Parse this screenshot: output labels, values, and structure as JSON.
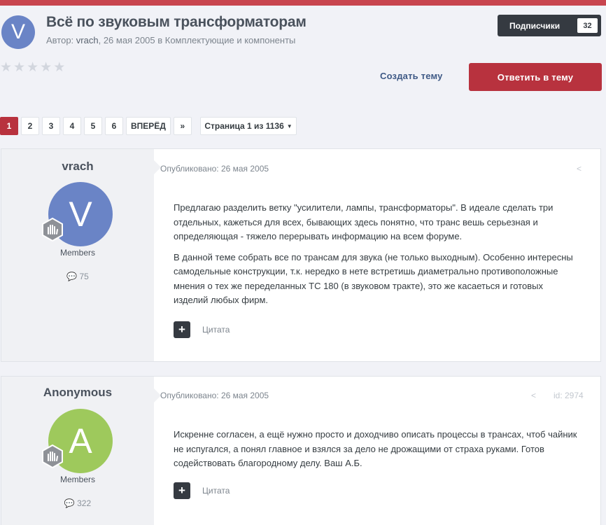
{
  "topic": {
    "avatar_letter": "V",
    "title": "Всё по звуковым трансформаторам",
    "author_prefix": "Автор:",
    "author": "vrach",
    "date_forum": ", 26 мая 2005 в Комплектующие и компоненты",
    "rating_stars": 5,
    "rating_value": 0
  },
  "follow": {
    "label": "Подписчики",
    "count": "32"
  },
  "actions": {
    "create": "Создать тему",
    "reply": "Ответить в тему"
  },
  "pagination": {
    "pages": [
      "1",
      "2",
      "3",
      "4",
      "5",
      "6"
    ],
    "current": "1",
    "next": "ВПЕРЁД",
    "last": "»",
    "page_select": "Страница 1 из 1136"
  },
  "posts": [
    {
      "username": "vrach",
      "avatar_letter": "V",
      "avatar_color": "#6a84c6",
      "group": "Members",
      "post_count": "75",
      "date": "Опубликовано: 26 мая 2005",
      "id": "",
      "paragraphs": [
        "Предлагаю разделить ветку \"усилители, лампы, трансформаторы\". В идеале сделать три отдельных, кажеться для всех, бывающих здесь понятно, что транс вешь серьезная и определяющая - тяжело перерывать информацию на всем форуме.",
        "В данной теме собрать все по трансам для звука (не только выходным). Особенно интересны самодельные конструкции, т.к. нередко в нете встретишь диаметрально противоположные мнения о тех же переделанных ТС 180 (в звуковом тракте), это же касаеться и готовых изделий любых фирм."
      ],
      "quote_label": "Цитата"
    },
    {
      "username": "Anonymous",
      "avatar_letter": "A",
      "avatar_color": "#9ec95c",
      "group": "Members",
      "post_count": "322",
      "date": "Опубликовано: 26 мая 2005",
      "id": "id: 2974",
      "paragraphs": [
        "Искренне согласен, а ещё нужно просто и доходчиво описать процессы в трансах, чтоб чайник не испугался, а понял главное и взялся за дело не дрожащими от страха руками. Готов содействовать благородному делу. Ваш А.Б."
      ],
      "quote_label": "Цитата"
    }
  ],
  "colors": {
    "accent": "#b8323e",
    "dark": "#353a41",
    "topbar": "#c8454f"
  }
}
